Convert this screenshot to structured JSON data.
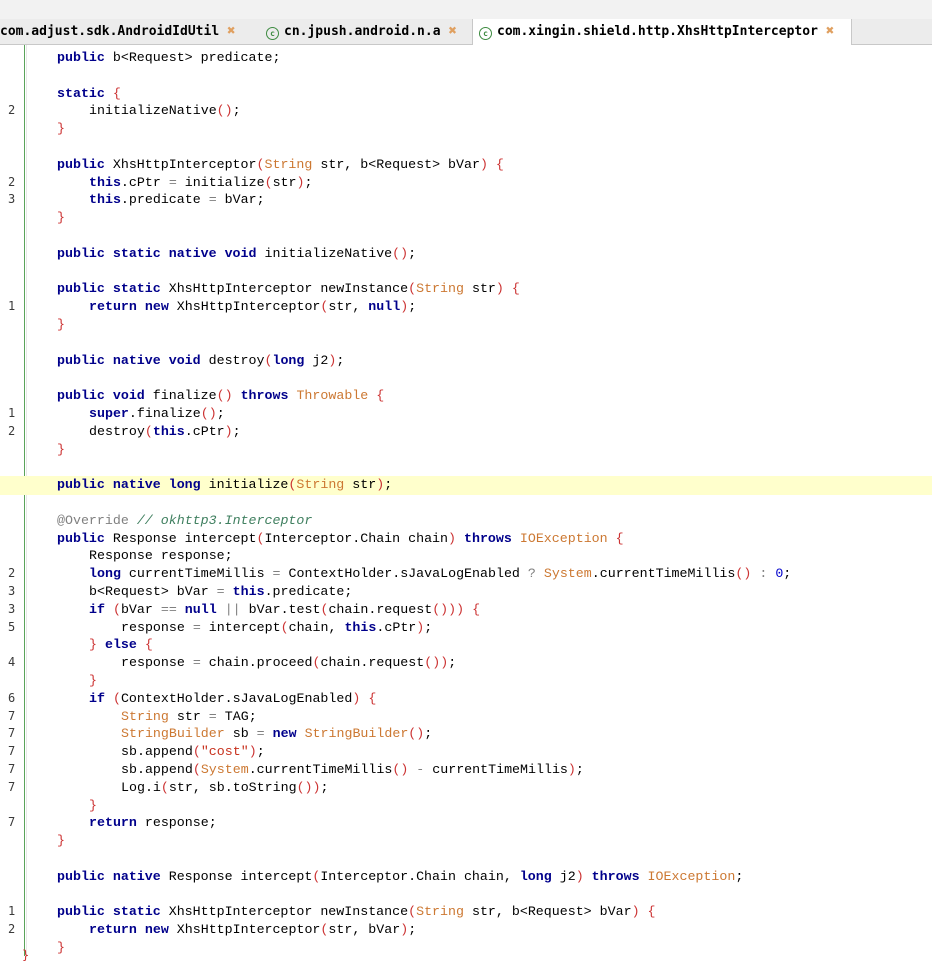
{
  "tabs": [
    {
      "label": "com.adjust.sdk.AndroidIdUtil",
      "active": false,
      "has_class_icon": false
    },
    {
      "label": "cn.jpush.android.n.a",
      "active": false,
      "has_class_icon": true
    },
    {
      "label": "com.xingin.shield.http.XhsHttpInterceptor",
      "active": true,
      "has_class_icon": true
    }
  ],
  "colors": {
    "keyword": "#00008b",
    "type": "#cc7832",
    "string": "#c8321e",
    "comment": "#3f7f5f",
    "highlight": "#ffffcc",
    "gutter": "#5aa35a"
  },
  "icons": {
    "class": "class-icon",
    "close": "close-icon"
  },
  "lines": [
    {
      "n": "",
      "indent": 1,
      "segs": [
        [
          "kw",
          "public"
        ],
        [
          "",
          " b<Request> predicate;"
        ]
      ]
    },
    {
      "n": "",
      "indent": 0,
      "segs": []
    },
    {
      "n": "",
      "indent": 1,
      "segs": [
        [
          "kw",
          "static"
        ],
        [
          "",
          " "
        ],
        [
          "br",
          "{"
        ]
      ]
    },
    {
      "n": "2",
      "indent": 2,
      "segs": [
        [
          "",
          "initializeNative"
        ],
        [
          "br",
          "()"
        ],
        [
          "",
          ";"
        ]
      ]
    },
    {
      "n": "",
      "indent": 1,
      "segs": [
        [
          "br",
          "}"
        ]
      ]
    },
    {
      "n": "",
      "indent": 0,
      "segs": []
    },
    {
      "n": "",
      "indent": 1,
      "segs": [
        [
          "kw",
          "public"
        ],
        [
          "",
          " XhsHttpInterceptor"
        ],
        [
          "br",
          "("
        ],
        [
          "ty",
          "String"
        ],
        [
          "",
          " str, b<Request> bVar"
        ],
        [
          "br",
          ")"
        ],
        [
          "",
          " "
        ],
        [
          "br",
          "{"
        ]
      ]
    },
    {
      "n": "2",
      "indent": 2,
      "segs": [
        [
          "kw",
          "this"
        ],
        [
          "",
          ".cPtr "
        ],
        [
          "op",
          "="
        ],
        [
          "",
          " initialize"
        ],
        [
          "br",
          "("
        ],
        [
          "",
          "str"
        ],
        [
          "br",
          ")"
        ],
        [
          "",
          ";"
        ]
      ]
    },
    {
      "n": "3",
      "indent": 2,
      "segs": [
        [
          "kw",
          "this"
        ],
        [
          "",
          ".predicate "
        ],
        [
          "op",
          "="
        ],
        [
          "",
          " bVar;"
        ]
      ]
    },
    {
      "n": "",
      "indent": 1,
      "segs": [
        [
          "br",
          "}"
        ]
      ]
    },
    {
      "n": "",
      "indent": 0,
      "segs": []
    },
    {
      "n": "",
      "indent": 1,
      "segs": [
        [
          "kw",
          "public static native void"
        ],
        [
          "",
          " initializeNative"
        ],
        [
          "br",
          "()"
        ],
        [
          "",
          ";"
        ]
      ]
    },
    {
      "n": "",
      "indent": 0,
      "segs": []
    },
    {
      "n": "",
      "indent": 1,
      "segs": [
        [
          "kw",
          "public static"
        ],
        [
          "",
          " XhsHttpInterceptor newInstance"
        ],
        [
          "br",
          "("
        ],
        [
          "ty",
          "String"
        ],
        [
          "",
          " str"
        ],
        [
          "br",
          ")"
        ],
        [
          "",
          " "
        ],
        [
          "br",
          "{"
        ]
      ]
    },
    {
      "n": "1",
      "indent": 2,
      "segs": [
        [
          "kw",
          "return new"
        ],
        [
          "",
          " XhsHttpInterceptor"
        ],
        [
          "br",
          "("
        ],
        [
          "",
          "str, "
        ],
        [
          "kw",
          "null"
        ],
        [
          "br",
          ")"
        ],
        [
          "",
          ";"
        ]
      ]
    },
    {
      "n": "",
      "indent": 1,
      "segs": [
        [
          "br",
          "}"
        ]
      ]
    },
    {
      "n": "",
      "indent": 0,
      "segs": []
    },
    {
      "n": "",
      "indent": 1,
      "segs": [
        [
          "kw",
          "public native void"
        ],
        [
          "",
          " destroy"
        ],
        [
          "br",
          "("
        ],
        [
          "kw",
          "long"
        ],
        [
          "",
          " j2"
        ],
        [
          "br",
          ")"
        ],
        [
          "",
          ";"
        ]
      ]
    },
    {
      "n": "",
      "indent": 0,
      "segs": []
    },
    {
      "n": "",
      "indent": 1,
      "segs": [
        [
          "kw",
          "public void"
        ],
        [
          "",
          " finalize"
        ],
        [
          "br",
          "()"
        ],
        [
          "",
          " "
        ],
        [
          "kw",
          "throws"
        ],
        [
          "",
          " "
        ],
        [
          "ty",
          "Throwable"
        ],
        [
          "",
          " "
        ],
        [
          "br",
          "{"
        ]
      ]
    },
    {
      "n": "1",
      "indent": 2,
      "segs": [
        [
          "kw",
          "super"
        ],
        [
          "",
          ".finalize"
        ],
        [
          "br",
          "()"
        ],
        [
          "",
          ";"
        ]
      ]
    },
    {
      "n": "2",
      "indent": 2,
      "segs": [
        [
          "",
          "destroy"
        ],
        [
          "br",
          "("
        ],
        [
          "kw",
          "this"
        ],
        [
          "",
          ".cPtr"
        ],
        [
          "br",
          ")"
        ],
        [
          "",
          ";"
        ]
      ]
    },
    {
      "n": "",
      "indent": 1,
      "segs": [
        [
          "br",
          "}"
        ]
      ]
    },
    {
      "n": "",
      "indent": 0,
      "segs": []
    },
    {
      "n": "",
      "indent": 1,
      "hl": true,
      "segs": [
        [
          "kw",
          "public native long"
        ],
        [
          "",
          " initialize"
        ],
        [
          "br",
          "("
        ],
        [
          "ty",
          "String"
        ],
        [
          "",
          " str"
        ],
        [
          "br",
          ")"
        ],
        [
          "",
          ";"
        ]
      ]
    },
    {
      "n": "",
      "indent": 0,
      "segs": []
    },
    {
      "n": "",
      "indent": 1,
      "segs": [
        [
          "an",
          "@Override"
        ],
        [
          "",
          " "
        ],
        [
          "cm",
          "// okhttp3.Interceptor"
        ]
      ]
    },
    {
      "n": "",
      "indent": 1,
      "segs": [
        [
          "kw",
          "public"
        ],
        [
          "",
          " Response intercept"
        ],
        [
          "br",
          "("
        ],
        [
          "",
          "Interceptor.Chain chain"
        ],
        [
          "br",
          ")"
        ],
        [
          "",
          " "
        ],
        [
          "kw",
          "throws"
        ],
        [
          "",
          " "
        ],
        [
          "ty",
          "IOException"
        ],
        [
          "",
          " "
        ],
        [
          "br",
          "{"
        ]
      ]
    },
    {
      "n": "",
      "indent": 2,
      "segs": [
        [
          "",
          "Response response;"
        ]
      ]
    },
    {
      "n": "2",
      "indent": 2,
      "segs": [
        [
          "kw",
          "long"
        ],
        [
          "",
          " currentTimeMillis "
        ],
        [
          "op",
          "="
        ],
        [
          "",
          " ContextHolder.sJavaLogEnabled "
        ],
        [
          "op",
          "?"
        ],
        [
          "",
          " "
        ],
        [
          "ty",
          "System"
        ],
        [
          "",
          ".currentTimeMillis"
        ],
        [
          "br",
          "()"
        ],
        [
          "",
          " "
        ],
        [
          "op",
          ":"
        ],
        [
          "",
          " "
        ],
        [
          "lit",
          "0"
        ],
        [
          "",
          ";"
        ]
      ]
    },
    {
      "n": "3",
      "indent": 2,
      "segs": [
        [
          "",
          "b<Request> bVar "
        ],
        [
          "op",
          "="
        ],
        [
          "",
          " "
        ],
        [
          "kw",
          "this"
        ],
        [
          "",
          ".predicate;"
        ]
      ]
    },
    {
      "n": "3",
      "indent": 2,
      "segs": [
        [
          "kw",
          "if"
        ],
        [
          "",
          " "
        ],
        [
          "br",
          "("
        ],
        [
          "",
          "bVar "
        ],
        [
          "op",
          "=="
        ],
        [
          "",
          " "
        ],
        [
          "kw",
          "null"
        ],
        [
          "",
          " "
        ],
        [
          "op",
          "||"
        ],
        [
          "",
          " bVar.test"
        ],
        [
          "br",
          "("
        ],
        [
          "",
          "chain.request"
        ],
        [
          "br",
          "()))"
        ],
        [
          "",
          " "
        ],
        [
          "br",
          "{"
        ]
      ]
    },
    {
      "n": "5",
      "indent": 3,
      "segs": [
        [
          "",
          "response "
        ],
        [
          "op",
          "="
        ],
        [
          "",
          " intercept"
        ],
        [
          "br",
          "("
        ],
        [
          "",
          "chain, "
        ],
        [
          "kw",
          "this"
        ],
        [
          "",
          ".cPtr"
        ],
        [
          "br",
          ")"
        ],
        [
          "",
          ";"
        ]
      ]
    },
    {
      "n": "",
      "indent": 2,
      "segs": [
        [
          "br",
          "}"
        ],
        [
          "",
          " "
        ],
        [
          "kw",
          "else"
        ],
        [
          "",
          " "
        ],
        [
          "br",
          "{"
        ]
      ]
    },
    {
      "n": "4",
      "indent": 3,
      "segs": [
        [
          "",
          "response "
        ],
        [
          "op",
          "="
        ],
        [
          "",
          " chain.proceed"
        ],
        [
          "br",
          "("
        ],
        [
          "",
          "chain.request"
        ],
        [
          "br",
          "())"
        ],
        [
          "",
          ";"
        ]
      ]
    },
    {
      "n": "",
      "indent": 2,
      "segs": [
        [
          "br",
          "}"
        ]
      ]
    },
    {
      "n": "6",
      "indent": 2,
      "segs": [
        [
          "kw",
          "if"
        ],
        [
          "",
          " "
        ],
        [
          "br",
          "("
        ],
        [
          "",
          "ContextHolder.sJavaLogEnabled"
        ],
        [
          "br",
          ")"
        ],
        [
          "",
          " "
        ],
        [
          "br",
          "{"
        ]
      ]
    },
    {
      "n": "7",
      "indent": 3,
      "segs": [
        [
          "ty",
          "String"
        ],
        [
          "",
          " str "
        ],
        [
          "op",
          "="
        ],
        [
          "",
          " TAG;"
        ]
      ]
    },
    {
      "n": "7",
      "indent": 3,
      "segs": [
        [
          "ty",
          "StringBuilder"
        ],
        [
          "",
          " sb "
        ],
        [
          "op",
          "="
        ],
        [
          "",
          " "
        ],
        [
          "kw",
          "new"
        ],
        [
          "",
          " "
        ],
        [
          "ty",
          "StringBuilder"
        ],
        [
          "br",
          "()"
        ],
        [
          "",
          ";"
        ]
      ]
    },
    {
      "n": "7",
      "indent": 3,
      "segs": [
        [
          "",
          "sb.append"
        ],
        [
          "br",
          "("
        ],
        [
          "str",
          "\"cost\""
        ],
        [
          "br",
          ")"
        ],
        [
          "",
          ";"
        ]
      ]
    },
    {
      "n": "7",
      "indent": 3,
      "segs": [
        [
          "",
          "sb.append"
        ],
        [
          "br",
          "("
        ],
        [
          "ty",
          "System"
        ],
        [
          "",
          ".currentTimeMillis"
        ],
        [
          "br",
          "()"
        ],
        [
          "",
          " "
        ],
        [
          "op",
          "-"
        ],
        [
          "",
          " currentTimeMillis"
        ],
        [
          "br",
          ")"
        ],
        [
          "",
          ";"
        ]
      ]
    },
    {
      "n": "7",
      "indent": 3,
      "segs": [
        [
          "",
          "Log.i"
        ],
        [
          "br",
          "("
        ],
        [
          "",
          "str, sb.toString"
        ],
        [
          "br",
          "())"
        ],
        [
          "",
          ";"
        ]
      ]
    },
    {
      "n": "",
      "indent": 2,
      "segs": [
        [
          "br",
          "}"
        ]
      ]
    },
    {
      "n": "7",
      "indent": 2,
      "segs": [
        [
          "kw",
          "return"
        ],
        [
          "",
          " response;"
        ]
      ]
    },
    {
      "n": "",
      "indent": 1,
      "segs": [
        [
          "br",
          "}"
        ]
      ]
    },
    {
      "n": "",
      "indent": 0,
      "segs": []
    },
    {
      "n": "",
      "indent": 1,
      "segs": [
        [
          "kw",
          "public native"
        ],
        [
          "",
          " Response intercept"
        ],
        [
          "br",
          "("
        ],
        [
          "",
          "Interceptor.Chain chain, "
        ],
        [
          "kw",
          "long"
        ],
        [
          "",
          " j2"
        ],
        [
          "br",
          ")"
        ],
        [
          "",
          " "
        ],
        [
          "kw",
          "throws"
        ],
        [
          "",
          " "
        ],
        [
          "ty",
          "IOException"
        ],
        [
          "",
          ";"
        ]
      ]
    },
    {
      "n": "",
      "indent": 0,
      "segs": []
    },
    {
      "n": "1",
      "indent": 1,
      "segs": [
        [
          "kw",
          "public static"
        ],
        [
          "",
          " XhsHttpInterceptor newInstance"
        ],
        [
          "br",
          "("
        ],
        [
          "ty",
          "String"
        ],
        [
          "",
          " str, b<Request> bVar"
        ],
        [
          "br",
          ")"
        ],
        [
          "",
          " "
        ],
        [
          "br",
          "{"
        ]
      ]
    },
    {
      "n": "2",
      "indent": 2,
      "segs": [
        [
          "kw",
          "return new"
        ],
        [
          "",
          " XhsHttpInterceptor"
        ],
        [
          "br",
          "("
        ],
        [
          "",
          "str, bVar"
        ],
        [
          "br",
          ")"
        ],
        [
          "",
          ";"
        ]
      ]
    },
    {
      "n": "",
      "indent": 1,
      "segs": [
        [
          "br",
          "}"
        ]
      ]
    }
  ],
  "closing_brace": "}"
}
